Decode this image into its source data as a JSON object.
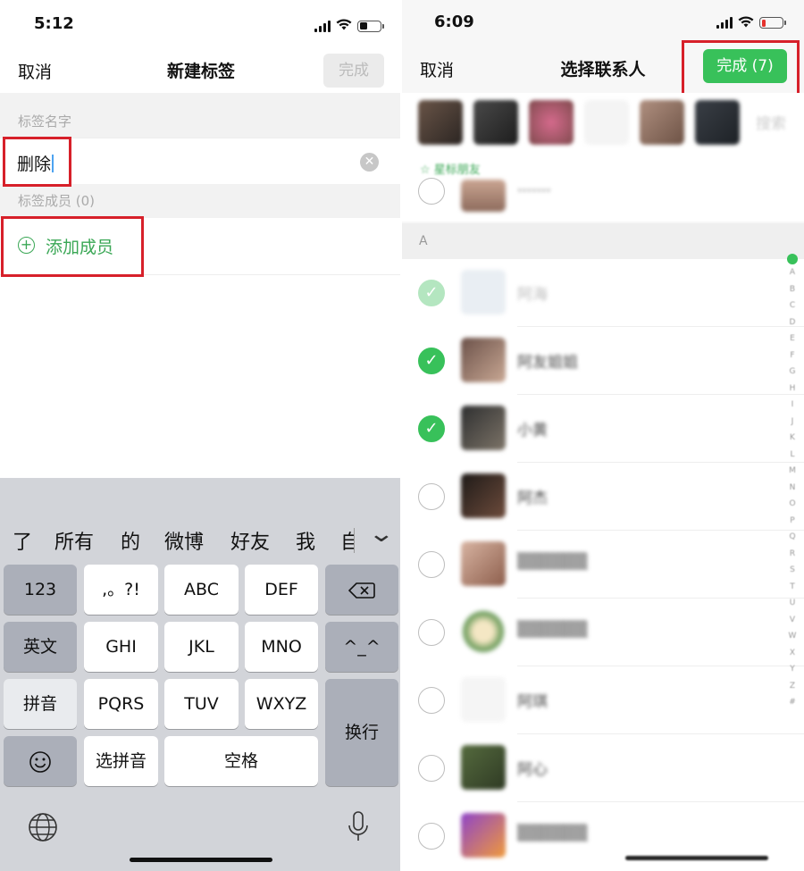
{
  "left": {
    "status": {
      "time": "5:12"
    },
    "nav": {
      "cancel": "取消",
      "title": "新建标签",
      "done": "完成"
    },
    "name_section_label": "标签名字",
    "name_value": "删除",
    "members_section_label": "标签成员 (0)",
    "add_member_label": "添加成员",
    "keyboard": {
      "suggestions": [
        "了",
        "所有",
        "的",
        "微博",
        "好友",
        "我",
        "自"
      ],
      "keys": {
        "num": "123",
        "punct": ",。?!",
        "abc": "ABC",
        "def": "DEF",
        "english": "英文",
        "ghi": "GHI",
        "jkl": "JKL",
        "mno": "MNO",
        "emoticon": "^_^",
        "pinyin": "拼音",
        "pqrs": "PQRS",
        "tuv": "TUV",
        "wxyz": "WXYZ",
        "enter": "换行",
        "choose_pinyin": "选拼音",
        "space": "空格"
      }
    }
  },
  "right": {
    "status": {
      "time": "6:09"
    },
    "nav": {
      "cancel": "取消",
      "title": "选择联系人",
      "done": "完成 (7)"
    },
    "search_placeholder": "搜索",
    "starred_label": "☆ 星标朋友",
    "section_letter": "A",
    "contacts": [
      {
        "name": "阿海",
        "state": "locked"
      },
      {
        "name": "阿友姐姐",
        "state": "checked"
      },
      {
        "name": "小黄",
        "state": "checked"
      },
      {
        "name": "阿杰",
        "state": "unchecked"
      },
      {
        "name": "",
        "state": "unchecked"
      },
      {
        "name": "",
        "state": "unchecked"
      },
      {
        "name": "阿琪",
        "state": "unchecked"
      },
      {
        "name": "阿心",
        "state": "unchecked"
      },
      {
        "name": "",
        "state": "unchecked"
      }
    ],
    "index_letters": [
      "A",
      "B",
      "C",
      "D",
      "E",
      "F",
      "G",
      "H",
      "I",
      "J",
      "K",
      "L",
      "M",
      "N",
      "O",
      "P",
      "Q",
      "R",
      "S",
      "T",
      "U",
      "V",
      "W",
      "X",
      "Y",
      "Z",
      "#"
    ]
  },
  "colors": {
    "accent_green": "#38c15a",
    "highlight_red": "#d7202a"
  }
}
